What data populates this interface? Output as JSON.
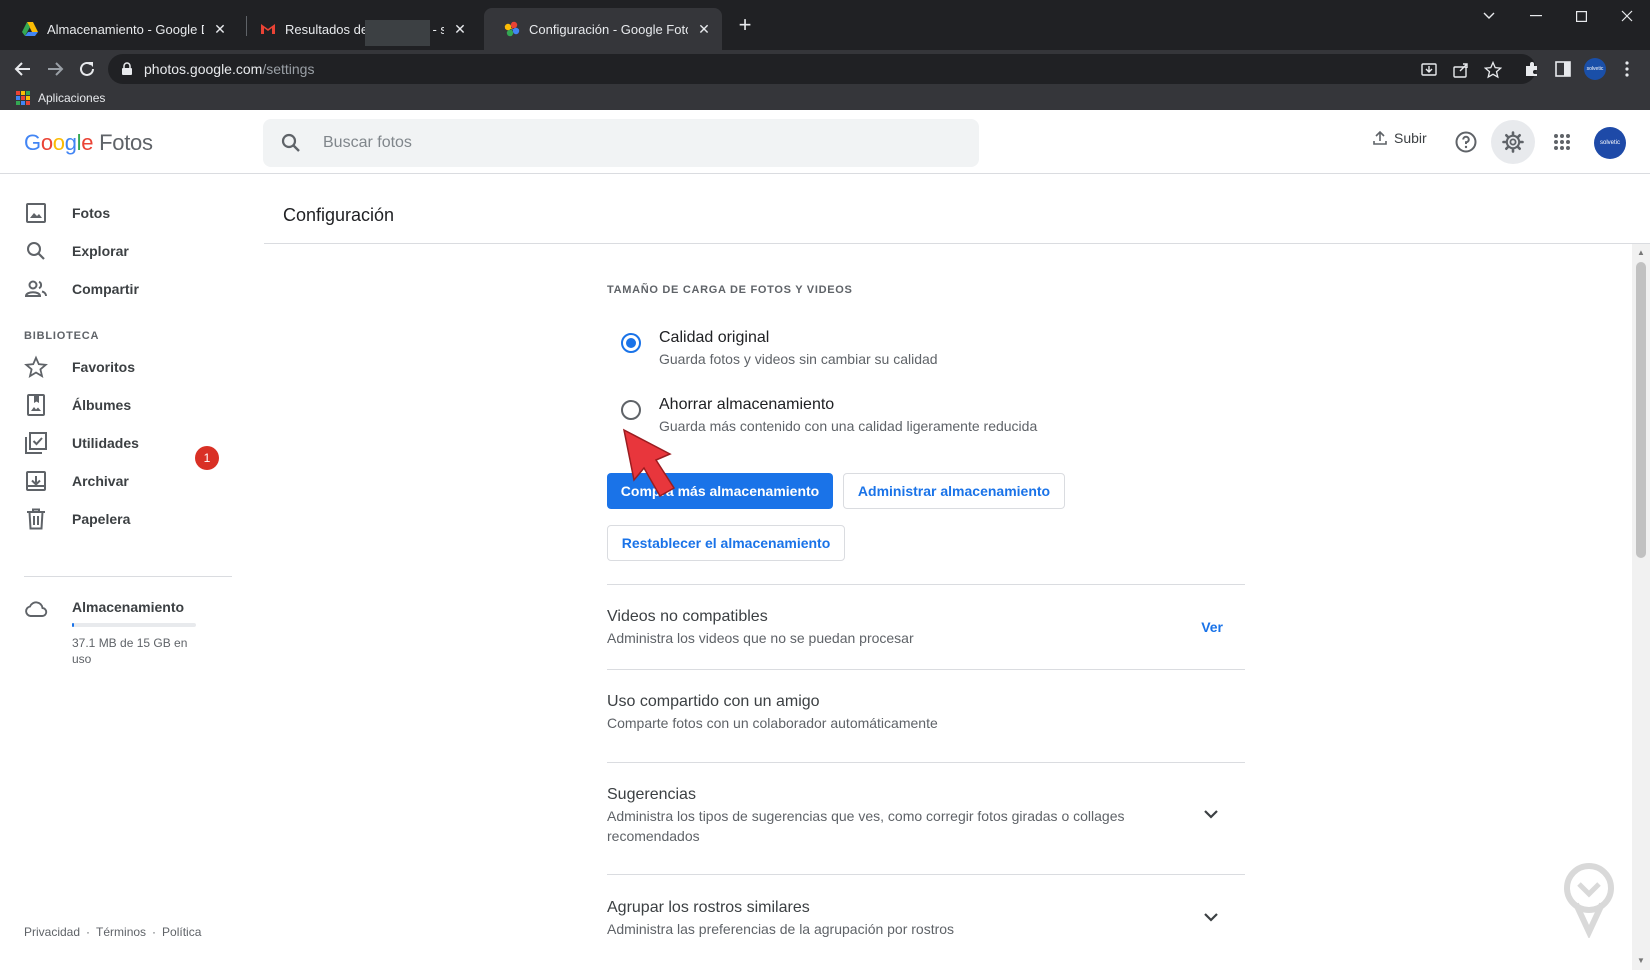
{
  "browser": {
    "tabs": [
      {
        "title": "Almacenamiento - Google Drive",
        "icon": "google-drive-icon",
        "active": false
      },
      {
        "title": "Resultados de búsqueda - solvetic",
        "icon": "gmail-icon",
        "active": false
      },
      {
        "title": "Configuración - Google Fotos",
        "icon": "google-photos-icon",
        "active": true
      }
    ],
    "url_host": "photos.google.com",
    "url_path": "/settings",
    "bookmark_apps": "Aplicaciones",
    "profile_initials": "solvetic"
  },
  "app": {
    "logo_google": [
      "G",
      "o",
      "o",
      "g",
      "l",
      "e"
    ],
    "logo_product": "Fotos",
    "search_placeholder": "Buscar fotos",
    "upload_label": "Subir",
    "user_initials": "solvetic"
  },
  "sidebar": {
    "items": [
      {
        "label": "Fotos",
        "icon": "image-icon"
      },
      {
        "label": "Explorar",
        "icon": "search-icon"
      },
      {
        "label": "Compartir",
        "icon": "people-icon"
      }
    ],
    "library_label": "BIBLIOTECA",
    "library_items": [
      {
        "label": "Favoritos",
        "icon": "star-icon"
      },
      {
        "label": "Álbumes",
        "icon": "album-icon"
      },
      {
        "label": "Utilidades",
        "icon": "utilities-icon",
        "badge": "1"
      },
      {
        "label": "Archivar",
        "icon": "archive-icon"
      },
      {
        "label": "Papelera",
        "icon": "trash-icon"
      }
    ],
    "storage": {
      "title": "Almacenamiento",
      "used_text": "37.1 MB de 15 GB en uso",
      "used_fraction": 0.0025
    },
    "footer": [
      "Privacidad",
      "·",
      "Términos",
      "·",
      "Política"
    ]
  },
  "settings": {
    "page_title": "Configuración",
    "upload_size_heading": "TAMAÑO DE CARGA DE FOTOS Y VIDEOS",
    "options": [
      {
        "title": "Calidad original",
        "subtitle": "Guarda fotos y videos sin cambiar su calidad",
        "selected": true
      },
      {
        "title": "Ahorrar almacenamiento",
        "subtitle": "Guarda más contenido con una calidad ligeramente reducida",
        "selected": false
      }
    ],
    "buy_storage_label": "Compra más almacenamiento",
    "manage_storage_label": "Administrar almacenamiento",
    "restore_storage_label": "Restablecer el almacenamiento",
    "rows": [
      {
        "title": "Videos no compatibles",
        "subtitle": "Administra los videos que no se puedan procesar",
        "action": "Ver"
      },
      {
        "title": "Uso compartido con un amigo",
        "subtitle": "Comparte fotos con un colaborador automáticamente"
      },
      {
        "title": "Sugerencias",
        "subtitle": "Administra los tipos de sugerencias que ves, como corregir fotos giradas o collages recomendados"
      },
      {
        "title": "Agrupar los rostros similares",
        "subtitle": "Administra las preferencias de la agrupación por rostros"
      }
    ]
  },
  "colors": {
    "accent": "#1a73e8",
    "badge": "#d93025",
    "annotation_arrow": "#e8363c"
  }
}
